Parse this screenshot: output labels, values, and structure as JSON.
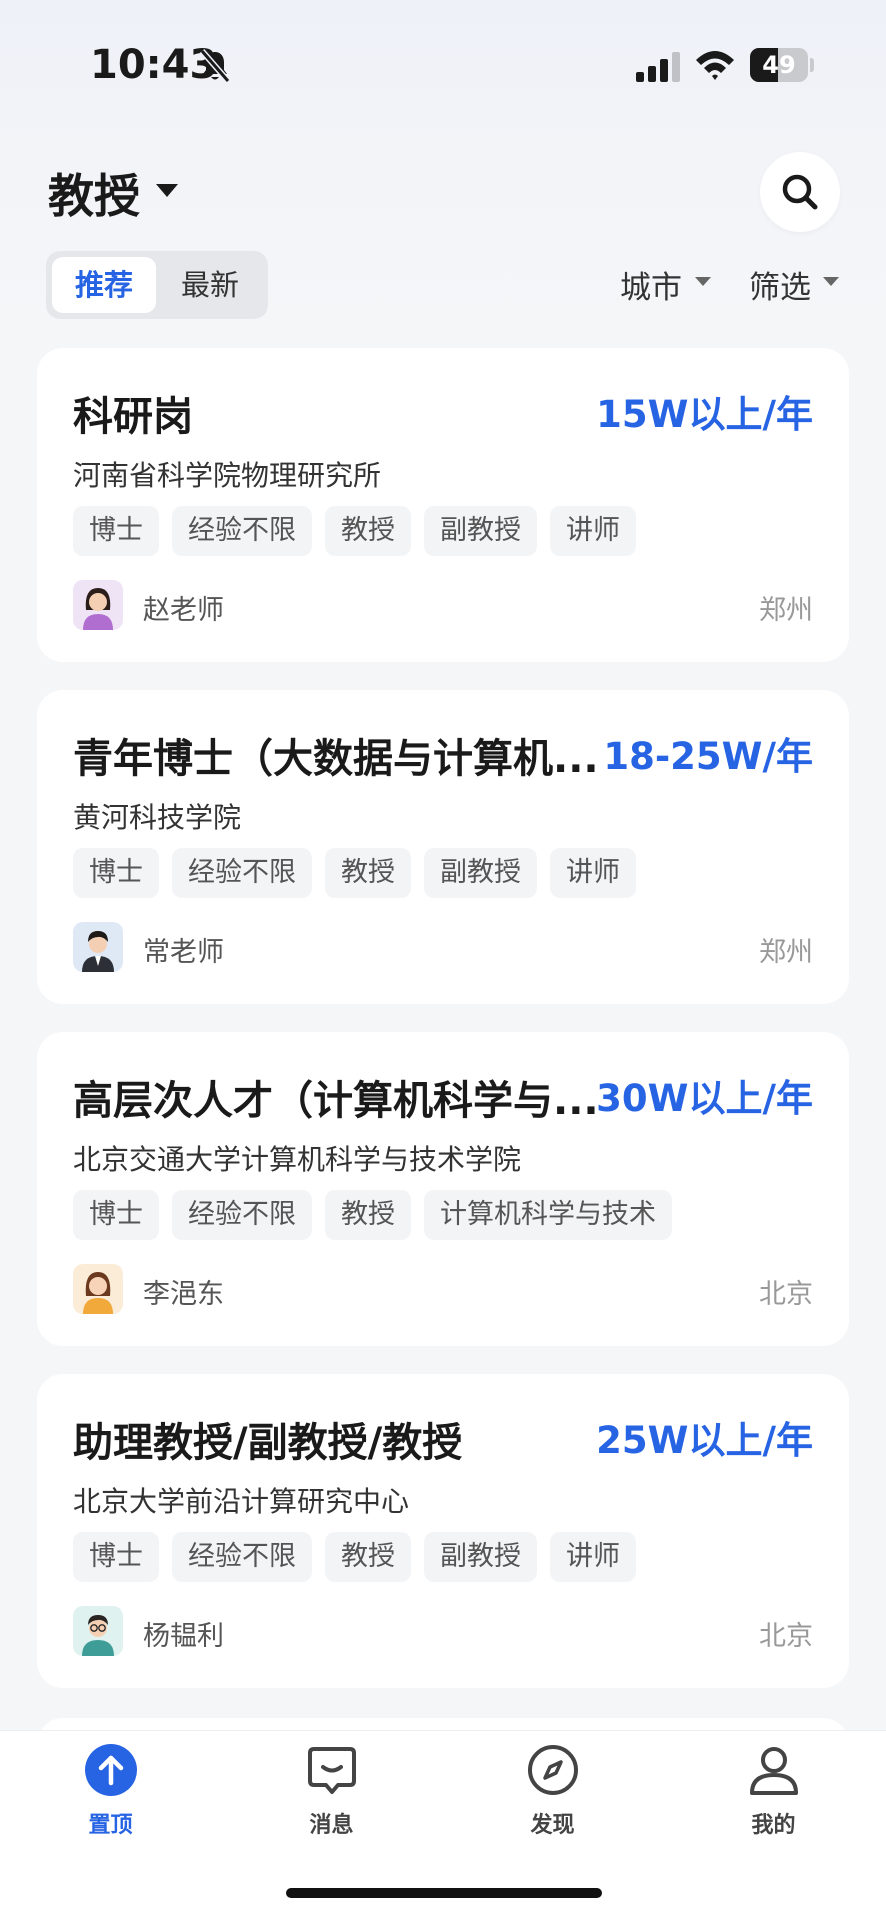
{
  "status_bar": {
    "time": "10:43",
    "battery": "49",
    "battery_level": 0.49
  },
  "header": {
    "title": "教授"
  },
  "segmented": {
    "recommend": "推荐",
    "latest": "最新"
  },
  "filters": {
    "city": "城市",
    "filter": "筛选"
  },
  "jobs": [
    {
      "title": "科研岗",
      "salary": "15W以上/年",
      "company": "河南省科学院物理研究所",
      "tags": [
        "博士",
        "经验不限",
        "教授",
        "副教授",
        "讲师"
      ],
      "recruiter": "赵老师",
      "city": "郑州",
      "avatar": "female-avatar-icon"
    },
    {
      "title": "青年博士（大数据与计算机...",
      "salary": "18-25W/年",
      "company": "黄河科技学院",
      "tags": [
        "博士",
        "经验不限",
        "教授",
        "副教授",
        "讲师"
      ],
      "recruiter": "常老师",
      "city": "郑州",
      "avatar": "male-suit-avatar-icon"
    },
    {
      "title": "高层次人才（计算机科学与...",
      "salary": "30W以上/年",
      "company": "北京交通大学计算机科学与技术学院",
      "tags": [
        "博士",
        "经验不限",
        "教授",
        "计算机科学与技术"
      ],
      "recruiter": "李浥东",
      "city": "北京",
      "avatar": "female-avatar-icon"
    },
    {
      "title": "助理教授/副教授/教授",
      "salary": "25W以上/年",
      "company": "北京大学前沿计算研究中心",
      "tags": [
        "博士",
        "经验不限",
        "教授",
        "副教授",
        "讲师"
      ],
      "recruiter": "杨韫利",
      "city": "北京",
      "avatar": "male-glasses-avatar-icon"
    }
  ],
  "tabbar": {
    "items": [
      {
        "label": "置顶",
        "icon": "arrow-up-icon",
        "active": true
      },
      {
        "label": "消息",
        "icon": "message-icon",
        "active": false
      },
      {
        "label": "发现",
        "icon": "compass-icon",
        "active": false
      },
      {
        "label": "我的",
        "icon": "profile-icon",
        "active": false
      }
    ]
  },
  "colors": {
    "accent": "#2764e3",
    "background": "#f5f6f8"
  }
}
